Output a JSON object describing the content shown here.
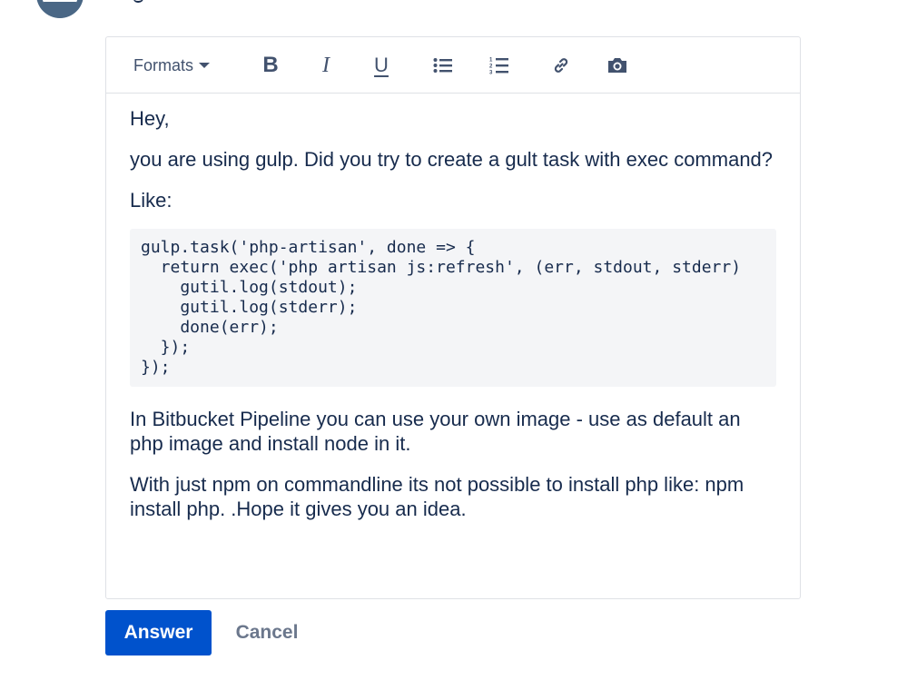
{
  "header": {
    "user_fragment": "ಲಿ"
  },
  "toolbar": {
    "formats_label": "Formats",
    "icons": [
      "bold-icon",
      "italic-icon",
      "underline-icon",
      "bullet-list-icon",
      "numbered-list-icon",
      "link-icon",
      "camera-icon"
    ]
  },
  "content": {
    "greeting": "Hey,",
    "para1": "you are using gulp. Did you try to create a gult task with exec command?",
    "like": "Like:",
    "code": "gulp.task('php-artisan', done => {\n  return exec('php artisan js:refresh', (err, stdout, stderr)\n    gutil.log(stdout);\n    gutil.log(stderr);\n    done(err);\n  });\n});",
    "para2": "In Bitbucket Pipeline you can use your own image - use as default an php image and install node in it.",
    "para3": "With just npm on commandline its not possible to install php like: npm install php. .Hope it gives you an idea."
  },
  "actions": {
    "answer_label": "Answer",
    "cancel_label": "Cancel"
  },
  "colors": {
    "primary": "#0052cc",
    "text": "#172b4d",
    "muted": "#6b778c",
    "border": "#dfe1e6",
    "code_bg": "#f4f5f7"
  }
}
